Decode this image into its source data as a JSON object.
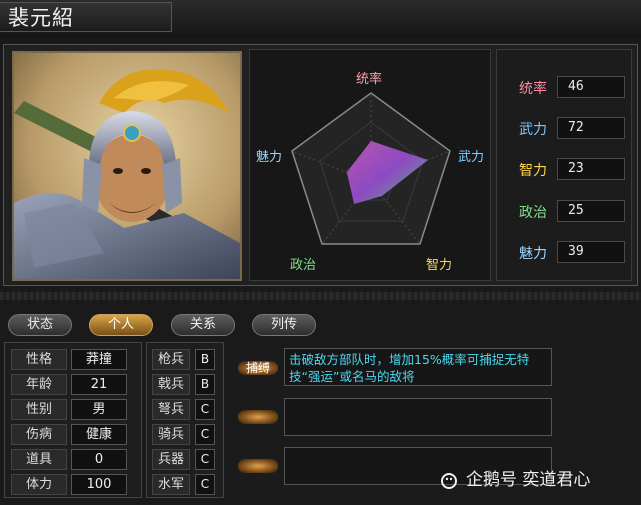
{
  "officer": {
    "name": "裴元紹"
  },
  "radar": {
    "labels": {
      "top": "统率",
      "right": "武力",
      "lower_right": "智力",
      "lower_left": "政治",
      "left": "魅力"
    },
    "label_colors": {
      "tong": "#ff9ea8",
      "wu": "#7fd0ff",
      "zhi": "#ffd84a",
      "zheng": "#7fe08a",
      "mei": "#9ad4ff"
    }
  },
  "stats": [
    {
      "label": "统率",
      "value": "46",
      "color": "#ff8aa0"
    },
    {
      "label": "武力",
      "value": "72",
      "color": "#7fc8ff"
    },
    {
      "label": "智力",
      "value": "23",
      "color": "#ffd84a"
    },
    {
      "label": "政治",
      "value": "25",
      "color": "#7fe08a"
    },
    {
      "label": "魅力",
      "value": "39",
      "color": "#9ad4ff"
    }
  ],
  "tabs": [
    {
      "label": "状态",
      "active": false
    },
    {
      "label": "个人",
      "active": true
    },
    {
      "label": "关系",
      "active": false
    },
    {
      "label": "列传",
      "active": false
    }
  ],
  "personal": [
    {
      "label": "性格",
      "value": "莽撞"
    },
    {
      "label": "年龄",
      "value": "21"
    },
    {
      "label": "性别",
      "value": "男"
    },
    {
      "label": "伤病",
      "value": "健康"
    },
    {
      "label": "道具",
      "value": "0"
    },
    {
      "label": "体力",
      "value": "100"
    }
  ],
  "aptitudes": [
    {
      "label": "枪兵",
      "value": "B"
    },
    {
      "label": "戟兵",
      "value": "B"
    },
    {
      "label": "弩兵",
      "value": "C"
    },
    {
      "label": "骑兵",
      "value": "C"
    },
    {
      "label": "兵器",
      "value": "C"
    },
    {
      "label": "水军",
      "value": "C"
    }
  ],
  "skills": [
    {
      "name": "捕缚",
      "description": "击破敌方部队时，增加15%概率可捕捉无特技“强运”或名马的敌将"
    },
    {
      "name": "",
      "description": ""
    },
    {
      "name": "",
      "description": ""
    }
  ],
  "watermark": {
    "text": "企鹅号 奕道君心"
  }
}
